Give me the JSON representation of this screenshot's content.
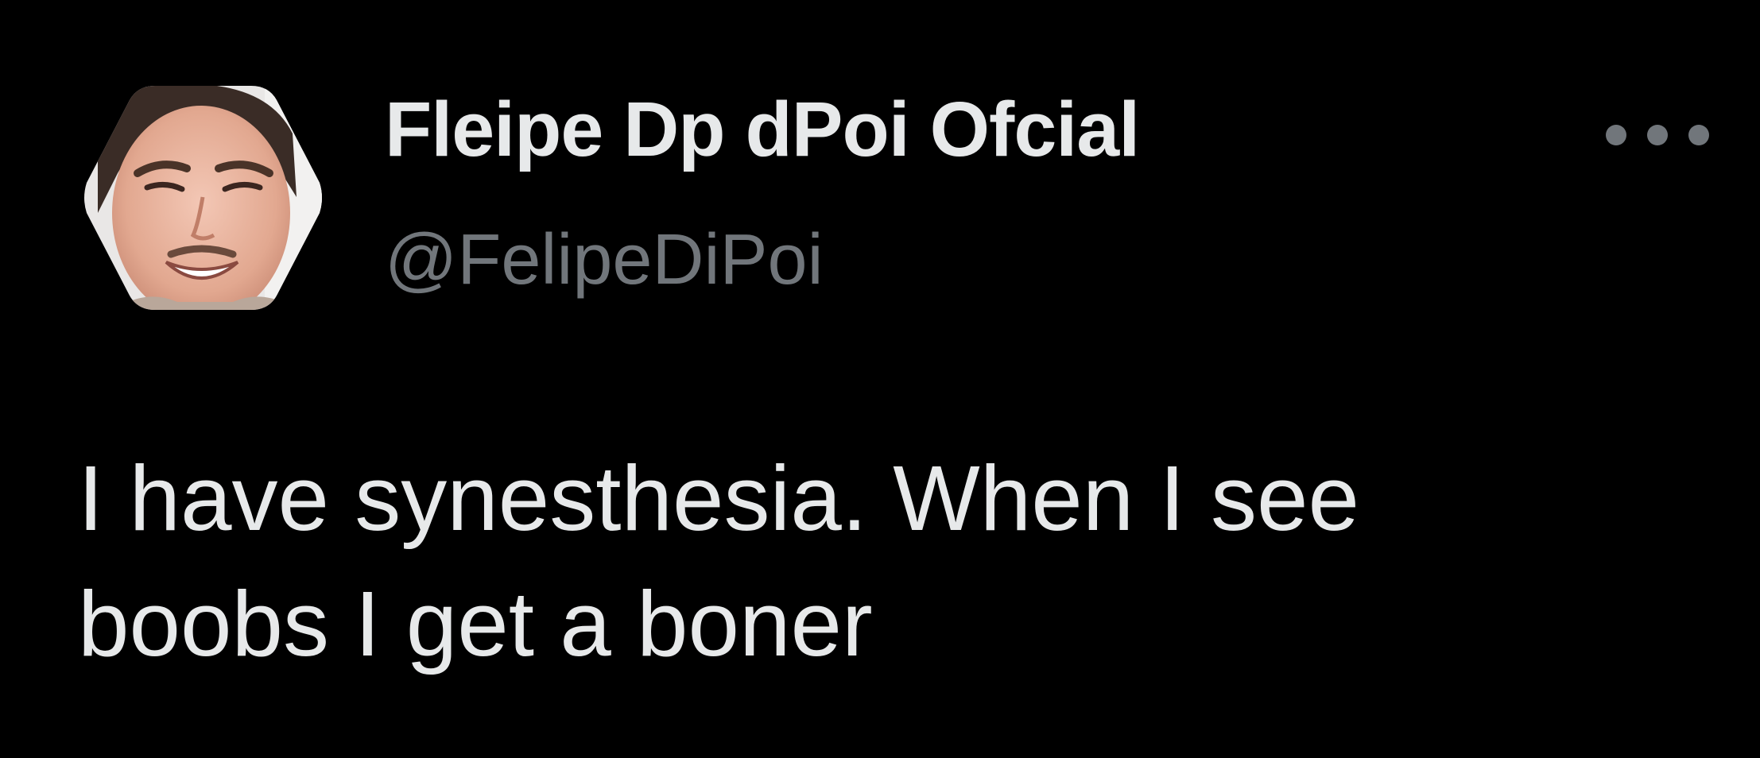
{
  "author": {
    "display_name": "Fleipe Dp dPoi Ofcial",
    "handle": "@FelipeDiPoi",
    "avatar": "profile-photo-hexagon"
  },
  "menu": {
    "icon": "more-horizontal-icon"
  },
  "tweet": {
    "text_lines": [
      "I have synesthesia. When I see",
      "boobs I get a boner"
    ]
  },
  "colors": {
    "background": "#000000",
    "primary_text": "#e7e9ea",
    "secondary_text": "#71767b"
  }
}
